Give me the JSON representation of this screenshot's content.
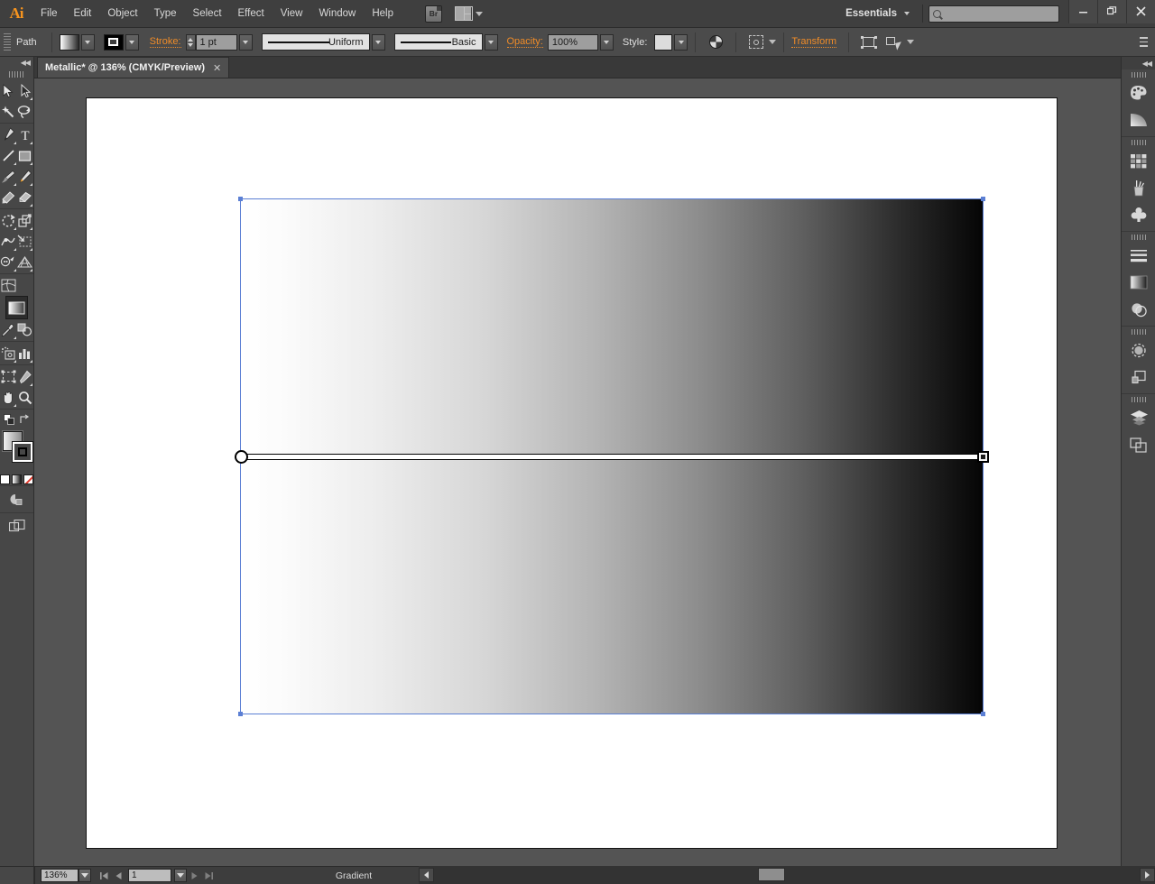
{
  "app": {
    "name": "Adobe Illustrator",
    "logo": "Ai"
  },
  "menubar": {
    "items": [
      "File",
      "Edit",
      "Object",
      "Type",
      "Select",
      "Effect",
      "View",
      "Window",
      "Help"
    ],
    "bridge_label": "Br",
    "workspace": "Essentials",
    "search_placeholder": "",
    "search_value": "",
    "window_buttons": {
      "minimize": "—",
      "restore": "❐",
      "close": "✕"
    }
  },
  "controlbar": {
    "object_type": "Path",
    "stroke_label": "Stroke:",
    "stroke_weight": "1 pt",
    "variable_width": "Uniform",
    "brush_definition": "Basic",
    "opacity_label": "Opacity:",
    "opacity_value": "100%",
    "style_label": "Style:",
    "transform_label": "Transform",
    "accent_color": "#f08c28"
  },
  "tab": {
    "title": "Metallic* @ 136% (CMYK/Preview)",
    "close": "✕"
  },
  "toolbar": {
    "collapse": "◀◀",
    "tools": [
      {
        "name": "selection-tool",
        "label": "Selection"
      },
      {
        "name": "direct-selection-tool",
        "label": "Direct Selection"
      },
      {
        "name": "magic-wand-tool",
        "label": "Magic Wand"
      },
      {
        "name": "lasso-tool",
        "label": "Lasso"
      },
      {
        "name": "pen-tool",
        "label": "Pen"
      },
      {
        "name": "type-tool",
        "label": "Type"
      },
      {
        "name": "line-segment-tool",
        "label": "Line Segment"
      },
      {
        "name": "rectangle-tool",
        "label": "Rectangle"
      },
      {
        "name": "paintbrush-tool",
        "label": "Paintbrush"
      },
      {
        "name": "pencil-tool",
        "label": "Pencil"
      },
      {
        "name": "blob-brush-tool",
        "label": "Blob Brush"
      },
      {
        "name": "eraser-tool",
        "label": "Eraser"
      },
      {
        "name": "rotate-tool",
        "label": "Rotate"
      },
      {
        "name": "scale-tool",
        "label": "Scale"
      },
      {
        "name": "width-tool",
        "label": "Width"
      },
      {
        "name": "free-transform-tool",
        "label": "Free Transform"
      },
      {
        "name": "shape-builder-tool",
        "label": "Shape Builder"
      },
      {
        "name": "perspective-grid-tool",
        "label": "Perspective Grid"
      },
      {
        "name": "mesh-tool",
        "label": "Mesh"
      },
      {
        "name": "gradient-tool",
        "label": "Gradient"
      },
      {
        "name": "eyedropper-tool",
        "label": "Eyedropper"
      },
      {
        "name": "blend-tool",
        "label": "Blend"
      },
      {
        "name": "symbol-sprayer-tool",
        "label": "Symbol Sprayer"
      },
      {
        "name": "column-graph-tool",
        "label": "Column Graph"
      },
      {
        "name": "artboard-tool",
        "label": "Artboard"
      },
      {
        "name": "slice-tool",
        "label": "Slice"
      },
      {
        "name": "hand-tool",
        "label": "Hand"
      },
      {
        "name": "zoom-tool",
        "label": "Zoom"
      }
    ],
    "active_tool": "gradient-tool",
    "fill_type": "gradient",
    "color_modes": [
      "color",
      "gradient",
      "none"
    ]
  },
  "dock": {
    "collapse": "◀◀",
    "panels": [
      {
        "name": "color-panel",
        "label": "Color"
      },
      {
        "name": "color-guide-panel",
        "label": "Color Guide"
      },
      {
        "name": "swatches-panel",
        "label": "Swatches"
      },
      {
        "name": "brushes-panel",
        "label": "Brushes"
      },
      {
        "name": "symbols-panel",
        "label": "Symbols"
      },
      {
        "name": "stroke-panel",
        "label": "Stroke"
      },
      {
        "name": "gradient-panel",
        "label": "Gradient"
      },
      {
        "name": "transparency-panel",
        "label": "Transparency"
      },
      {
        "name": "appearance-panel",
        "label": "Appearance"
      },
      {
        "name": "graphic-styles-panel",
        "label": "Graphic Styles"
      },
      {
        "name": "layers-panel",
        "label": "Layers"
      },
      {
        "name": "artboards-panel",
        "label": "Artboards"
      }
    ]
  },
  "canvas": {
    "artboard_background": "#ffffff",
    "pasteboard_background": "#545454",
    "selection_color": "#5b7fd4",
    "shape": {
      "name": "gradient-rectangle",
      "gradient_type": "linear",
      "gradient_angle_deg": 0,
      "stops": [
        {
          "position": 0,
          "color": "#ffffff"
        },
        {
          "position": 100,
          "color": "#000000"
        }
      ]
    },
    "gradient_annotator": {
      "origin_handle": "circle",
      "end_handle": "square"
    }
  },
  "statusbar": {
    "zoom": "136%",
    "page": "1",
    "status_text": "Gradient",
    "first_page": "|◀",
    "prev_page": "◀",
    "next_page": "▶",
    "last_page": "▶|"
  }
}
